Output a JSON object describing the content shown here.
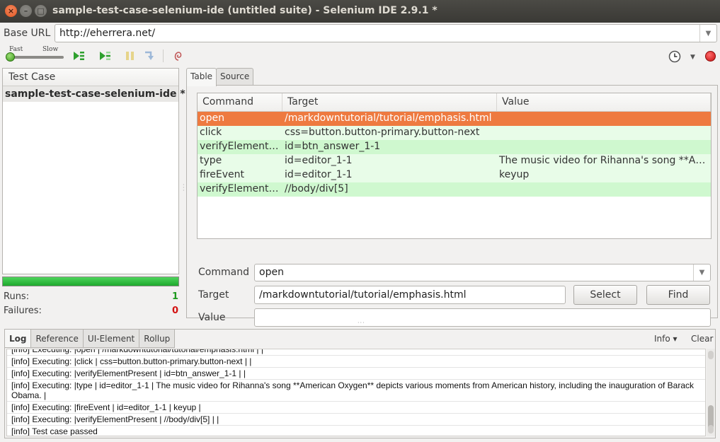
{
  "window": {
    "title": "sample-test-case-selenium-ide (untitled suite) - Selenium IDE 2.9.1 *",
    "close_glyph": "×",
    "min_glyph": "–",
    "max_glyph": "□"
  },
  "base_url": {
    "label": "Base URL",
    "value": "http://eherrera.net/"
  },
  "toolbar": {
    "speed_fast": "Fast",
    "speed_slow": "Slow",
    "icons": [
      "play-all-icon",
      "play-current-icon",
      "pause-icon",
      "step-icon",
      "rollup-icon",
      "clock-icon",
      "record-icon"
    ],
    "accent_green": "#2ea02e",
    "record_color": "#d01414"
  },
  "test_case_panel": {
    "header": "Test Case",
    "items": [
      {
        "label": "sample-test-case-selenium-ide *"
      }
    ],
    "progress": 1.0,
    "runs_label": "Runs:",
    "runs_value": "1",
    "failures_label": "Failures:",
    "failures_value": "0"
  },
  "editor": {
    "tabs": [
      {
        "label": "Table",
        "active": true
      },
      {
        "label": "Source",
        "active": false
      }
    ],
    "columns": [
      "Command",
      "Target",
      "Value"
    ],
    "rows": [
      {
        "command": "open",
        "target": "/markdowntutorial/tutorial/emphasis.html",
        "value": "",
        "state": "selected"
      },
      {
        "command": "click",
        "target": "css=button.button-primary.button-next",
        "value": "",
        "state": "light"
      },
      {
        "command": "verifyElement…",
        "target": "id=btn_answer_1-1",
        "value": "",
        "state": "green"
      },
      {
        "command": "type",
        "target": "id=editor_1-1",
        "value": "The music video for Rihanna's song **Ame…",
        "state": "light"
      },
      {
        "command": "fireEvent",
        "target": "id=editor_1-1",
        "value": "keyup",
        "state": "light"
      },
      {
        "command": "verifyElement…",
        "target": "//body/div[5]",
        "value": "",
        "state": "green"
      }
    ],
    "command_label": "Command",
    "command_value": "open",
    "target_label": "Target",
    "target_value": "/markdowntutorial/tutorial/emphasis.html",
    "value_label": "Value",
    "value_value": "",
    "select_button": "Select",
    "find_button": "Find"
  },
  "log_panel": {
    "tabs": [
      {
        "label": "Log",
        "active": true
      },
      {
        "label": "Reference",
        "active": false
      },
      {
        "label": "UI-Element",
        "active": false
      },
      {
        "label": "Rollup",
        "active": false
      }
    ],
    "info_label": "Info ▾",
    "clear_label": "Clear",
    "lines": [
      "[info] Executing: |open | /markdowntutorial/tutorial/emphasis.html | |",
      "[info] Executing: |click | css=button.button-primary.button-next | |",
      "[info] Executing: |verifyElementPresent | id=btn_answer_1-1 | |",
      "[info] Executing: |type | id=editor_1-1 | The music video for Rihanna's song **American Oxygen** depicts various moments from American history, including the inauguration of Barack Obama. |",
      "[info] Executing: |fireEvent | id=editor_1-1 | keyup |",
      "[info] Executing: |verifyElementPresent | //body/div[5] | |",
      "[info] Test case passed"
    ]
  }
}
